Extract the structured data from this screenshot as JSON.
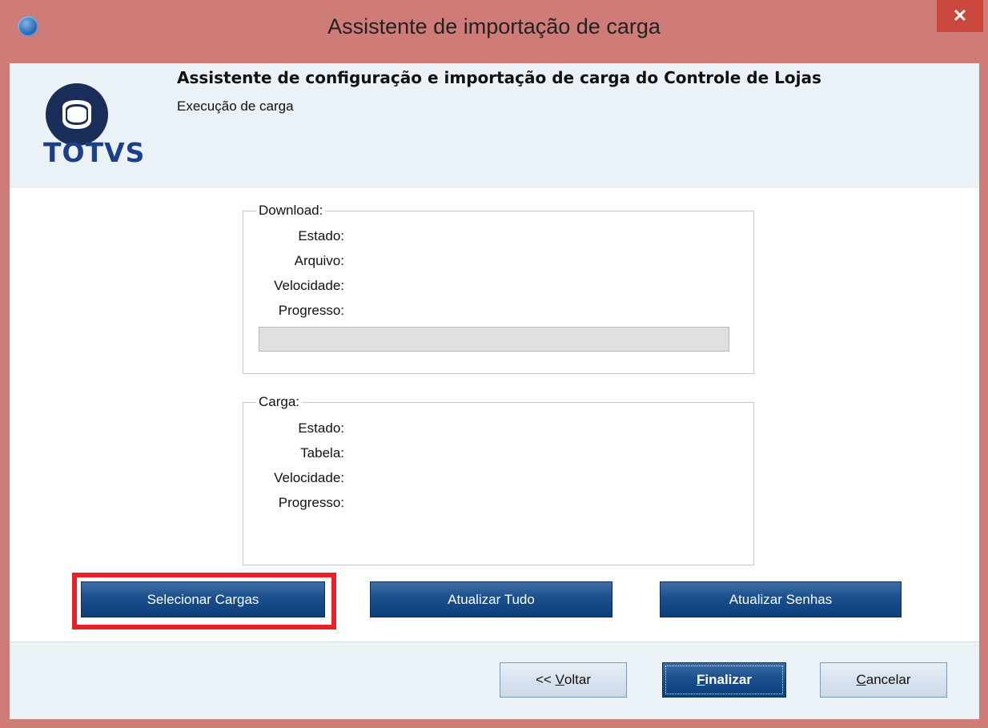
{
  "window": {
    "title": "Assistente de importação de carga",
    "close_glyph": "✕"
  },
  "header": {
    "logo_text": "TOTVS",
    "title": "Assistente de configuração e importação de carga do Controle de Lojas",
    "subtitle": "Execução de carga"
  },
  "download": {
    "legend": "Download:",
    "labels": {
      "estado": "Estado:",
      "arquivo": "Arquivo:",
      "velocidade": "Velocidade:",
      "progresso": "Progresso:"
    },
    "progress": 0
  },
  "carga": {
    "legend": "Carga:",
    "labels": {
      "estado": "Estado:",
      "tabela": "Tabela:",
      "velocidade": "Velocidade:",
      "progresso": "Progresso:"
    }
  },
  "actions": {
    "selecionar_cargas": "Selecionar Cargas",
    "atualizar_tudo": "Atualizar Tudo",
    "atualizar_senhas": "Atualizar Senhas"
  },
  "footer": {
    "voltar_prefix": "<< ",
    "voltar_mnemonic": "V",
    "voltar_rest": "oltar",
    "finalizar_mnemonic": "F",
    "finalizar_rest": "inalizar",
    "cancelar_mnemonic": "C",
    "cancelar_rest": "ancelar"
  },
  "colors": {
    "window_frame": "#cf7b78",
    "header_bg": "#eaf1f7",
    "primary_button": "#1a4f8d",
    "highlight": "#e8202a",
    "logo_blue": "#1b3f8b"
  },
  "icons": {
    "app": "app-globe-icon",
    "close": "close-icon",
    "logo": "totvs-logo"
  }
}
